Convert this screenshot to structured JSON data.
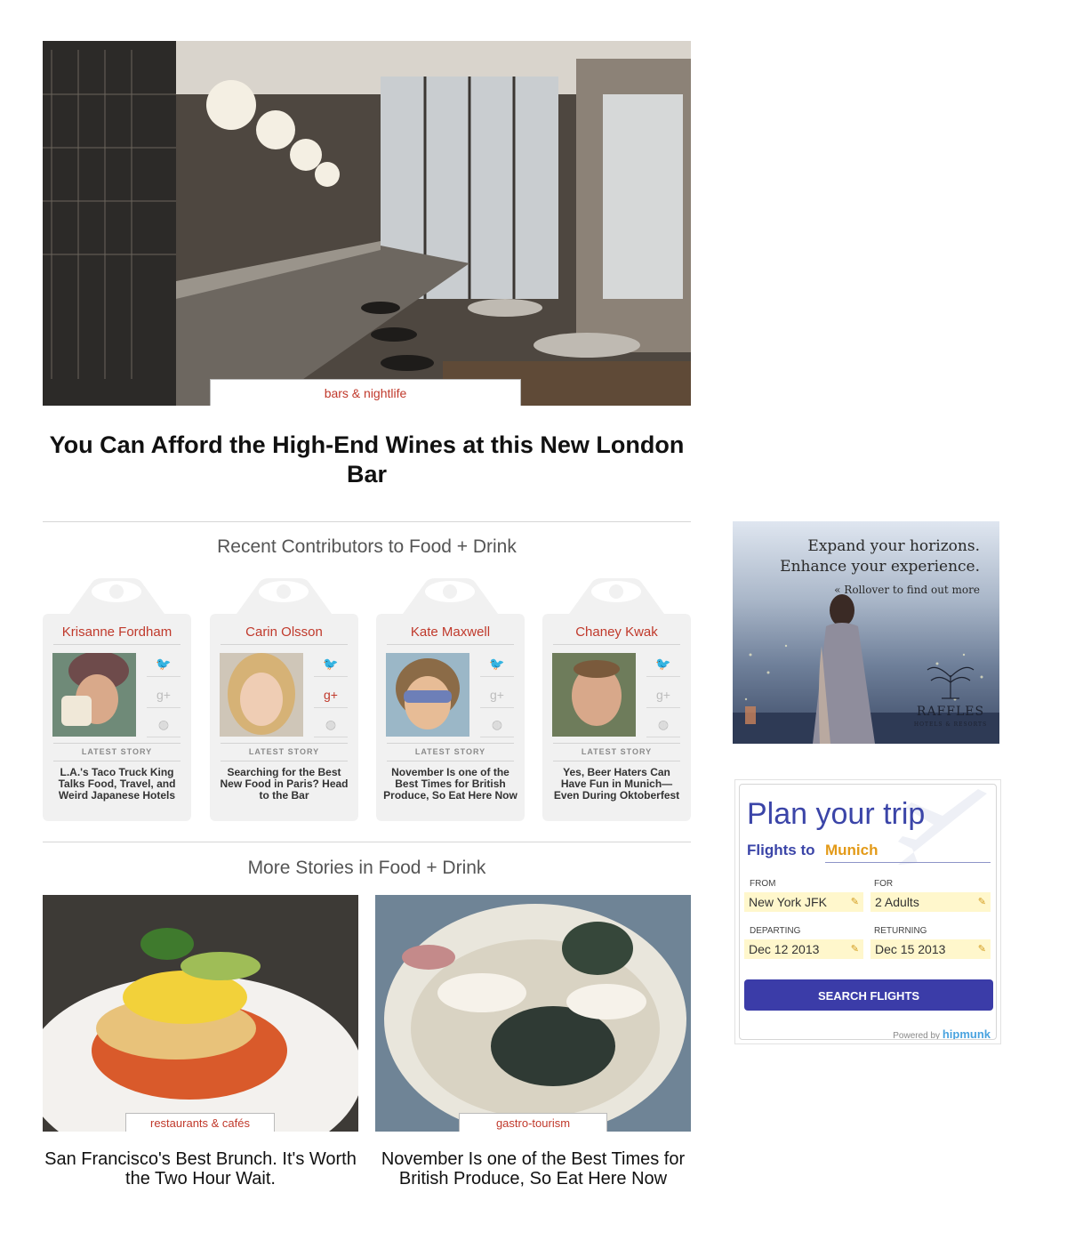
{
  "hero": {
    "category": "bars & nightlife",
    "title": "You Can Afford the High-End Wines at this New London Bar"
  },
  "contributors": {
    "heading": "Recent Contributors to Food + Drink",
    "latest_label": "LATEST STORY",
    "items": [
      {
        "name": "Krisanne Fordham",
        "latest": "L.A.'s Taco Truck King Talks Food, Travel, and Weird Japanese Hotels",
        "gplus_active": false
      },
      {
        "name": "Carin Olsson",
        "latest": "Searching for the Best New Food in Paris? Head to the Bar",
        "gplus_active": true
      },
      {
        "name": "Kate Maxwell",
        "latest": "November Is one of the Best Times for British Produce, So Eat Here Now",
        "gplus_active": false
      },
      {
        "name": "Chaney Kwak",
        "latest": "Yes, Beer Haters Can Have Fun in Munich—Even During Oktoberfest",
        "gplus_active": false
      }
    ],
    "icons": [
      "twitter-icon",
      "google-plus-icon",
      "globe-icon"
    ]
  },
  "stories": {
    "heading": "More Stories in Food + Drink",
    "items": [
      {
        "category": "restaurants & cafés",
        "title": "San Francisco's Best Brunch. It's Worth the Two Hour Wait."
      },
      {
        "category": "gastro-tourism",
        "title": "November Is one of the Best Times for British Produce, So Eat Here Now"
      }
    ]
  },
  "ad_raffles": {
    "line1": "Expand your horizons.",
    "line2": "Enhance your experience.",
    "rollover": "Rollover to find out more",
    "brand": "RAFFLES",
    "brand_sub": "HOTELS & RESORTS"
  },
  "hipmunk": {
    "title": "Plan your trip",
    "flights_to": "Flights to",
    "destination": "Munich",
    "from_label": "FROM",
    "from_value": "New York JFK",
    "for_label": "FOR",
    "for_value": "2 Adults",
    "departing_label": "DEPARTING",
    "departing_value": "Dec 12 2013",
    "returning_label": "RETURNING",
    "returning_value": "Dec 15 2013",
    "button": "SEARCH FLIGHTS",
    "powered_by": "Powered by",
    "brand": "hipmunk"
  },
  "colors": {
    "accent_red": "#c0392b",
    "hipmunk_blue": "#3b3ca8",
    "hipmunk_orange": "#e39a18",
    "field_yellow": "#fff7cc"
  }
}
